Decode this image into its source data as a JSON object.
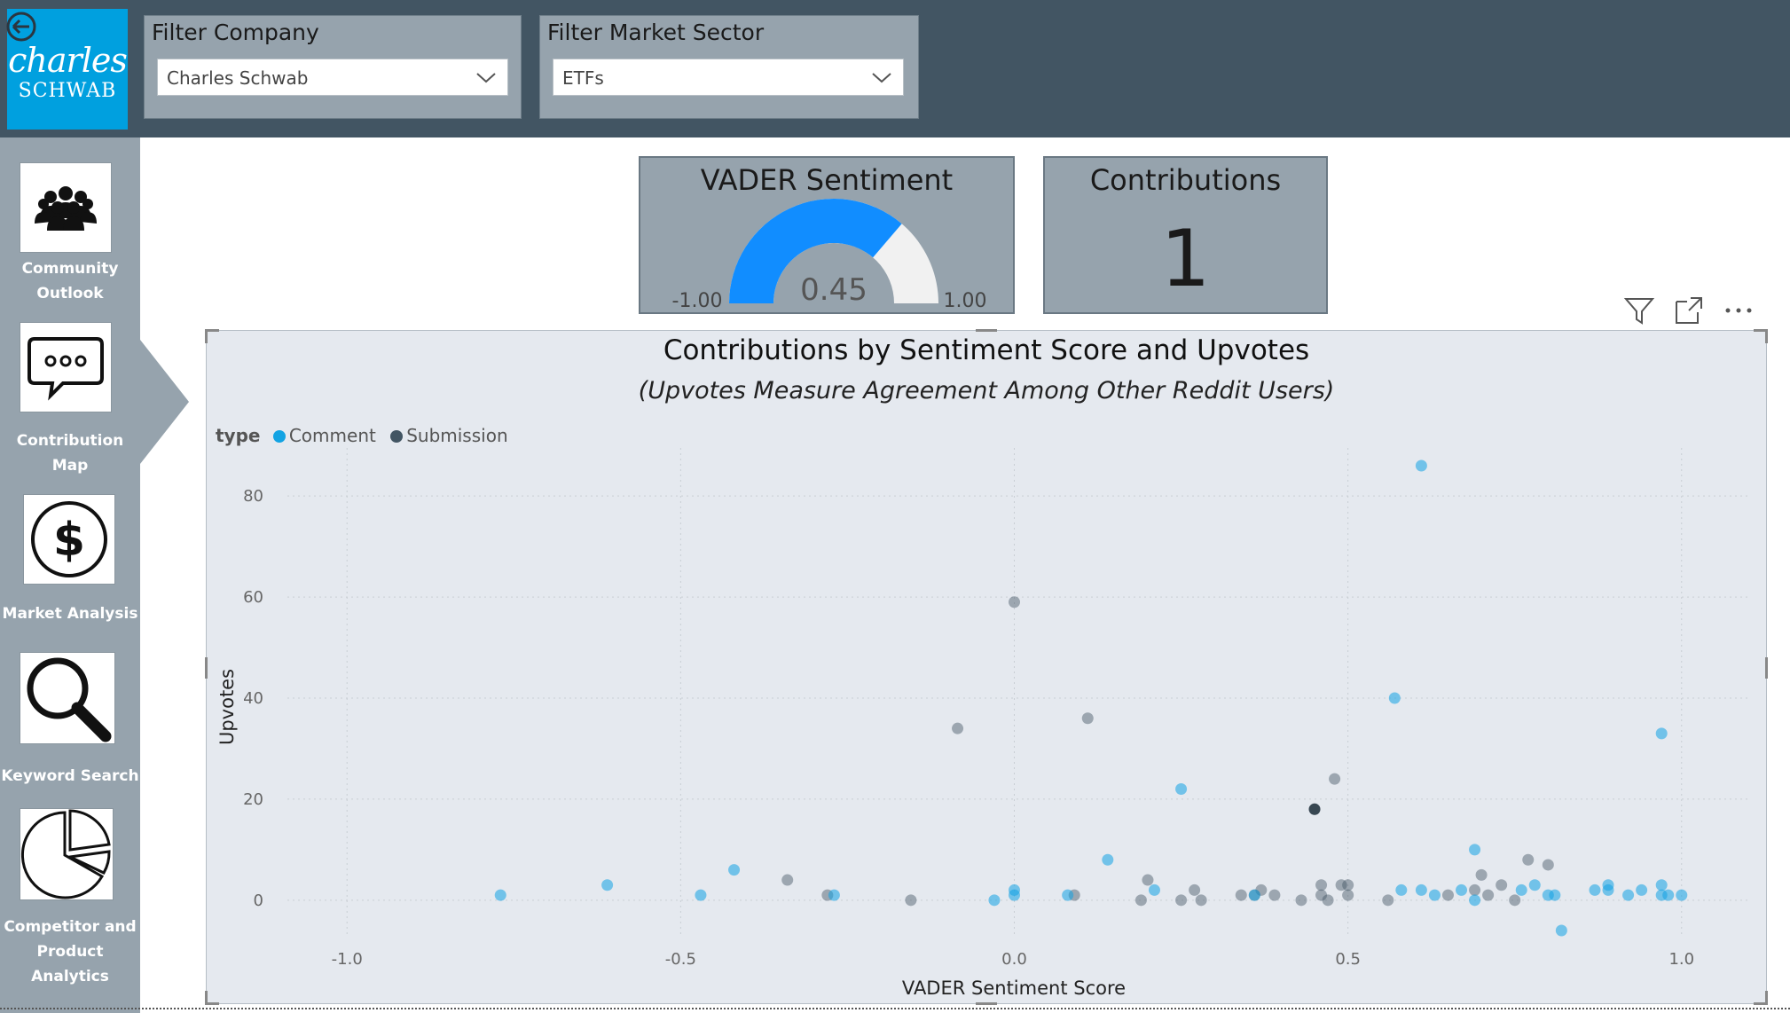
{
  "logo": {
    "line1": "charles",
    "line2": "SCHWAB",
    "color": "#00a0df"
  },
  "filters": [
    {
      "title": "Filter Company",
      "value": "Charles Schwab"
    },
    {
      "title": "Filter Market Sector",
      "value": "ETFs"
    }
  ],
  "sidebar": {
    "items": [
      {
        "label": "Community Outlook",
        "icon": "community-icon"
      },
      {
        "label": "Contribution Map",
        "icon": "speech-bubble-icon"
      },
      {
        "label": "Market Analysis",
        "icon": "dollar-icon"
      },
      {
        "label": "Keyword Search",
        "icon": "magnifier-icon"
      },
      {
        "label": "Competitor and Product Analytics",
        "icon": "pie-chart-icon"
      }
    ]
  },
  "cards": {
    "sentiment": {
      "title": "VADER Sentiment",
      "value": "0.45",
      "min": "-1.00",
      "max": "1.00",
      "value_num": 0.45,
      "fill_color": "#118dff"
    },
    "contributions": {
      "title": "Contributions",
      "value": "1"
    }
  },
  "colors": {
    "topbar": "#425563",
    "panel": "#96a3ad",
    "comment": "#12a3e3",
    "submission": "#425563"
  },
  "chart_data": {
    "type": "scatter",
    "title": "Contributions by Sentiment Score and Upvotes",
    "subtitle": "(Upvotes Measure Agreement Among Other Reddit Users)",
    "xlabel": "VADER Sentiment Score",
    "ylabel": "Upvotes",
    "legend_title": "type",
    "legend_position": "top-left",
    "xlim": [
      -1.1,
      1.1
    ],
    "ylim": [
      -6,
      86
    ],
    "x_ticks": [
      "-1.0",
      "-0.5",
      "0.0",
      "0.5",
      "1.0"
    ],
    "y_ticks": [
      "0",
      "20",
      "40",
      "60",
      "80"
    ],
    "grid": true,
    "series": [
      {
        "name": "Comment",
        "color": "#12a3e3",
        "points": [
          [
            -0.77,
            1
          ],
          [
            -0.61,
            3
          ],
          [
            -0.47,
            1
          ],
          [
            -0.42,
            6
          ],
          [
            -0.27,
            1
          ],
          [
            -0.03,
            0
          ],
          [
            0.0,
            1
          ],
          [
            0.0,
            2
          ],
          [
            0.08,
            1
          ],
          [
            0.14,
            8
          ],
          [
            0.21,
            2
          ],
          [
            0.25,
            22
          ],
          [
            0.36,
            1
          ],
          [
            0.57,
            40
          ],
          [
            0.58,
            2
          ],
          [
            0.61,
            2
          ],
          [
            0.61,
            86
          ],
          [
            0.63,
            1
          ],
          [
            0.67,
            2
          ],
          [
            0.69,
            0
          ],
          [
            0.69,
            10
          ],
          [
            0.76,
            2
          ],
          [
            0.78,
            3
          ],
          [
            0.8,
            1
          ],
          [
            0.81,
            1
          ],
          [
            0.82,
            -6
          ],
          [
            0.87,
            2
          ],
          [
            0.89,
            2
          ],
          [
            0.89,
            3
          ],
          [
            0.92,
            1
          ],
          [
            0.94,
            2
          ],
          [
            0.97,
            1
          ],
          [
            0.97,
            3
          ],
          [
            0.97,
            33
          ],
          [
            0.98,
            1
          ],
          [
            1.0,
            1
          ]
        ]
      },
      {
        "name": "Submission",
        "color": "#425563",
        "points": [
          [
            -0.34,
            4
          ],
          [
            -0.28,
            1
          ],
          [
            -0.155,
            0
          ],
          [
            -0.085,
            34
          ],
          [
            0.0,
            59
          ],
          [
            0.09,
            1
          ],
          [
            0.11,
            36
          ],
          [
            0.19,
            0
          ],
          [
            0.2,
            4
          ],
          [
            0.25,
            0
          ],
          [
            0.27,
            2
          ],
          [
            0.28,
            0
          ],
          [
            0.34,
            1
          ],
          [
            0.36,
            1
          ],
          [
            0.37,
            2
          ],
          [
            0.39,
            1
          ],
          [
            0.43,
            0
          ],
          [
            0.45,
            18
          ],
          [
            0.46,
            1
          ],
          [
            0.46,
            3
          ],
          [
            0.47,
            0
          ],
          [
            0.48,
            24
          ],
          [
            0.49,
            3
          ],
          [
            0.5,
            1
          ],
          [
            0.5,
            3
          ],
          [
            0.56,
            0
          ],
          [
            0.65,
            1
          ],
          [
            0.69,
            2
          ],
          [
            0.7,
            5
          ],
          [
            0.71,
            1
          ],
          [
            0.73,
            3
          ],
          [
            0.75,
            0
          ],
          [
            0.77,
            8
          ],
          [
            0.8,
            7
          ]
        ]
      }
    ]
  }
}
